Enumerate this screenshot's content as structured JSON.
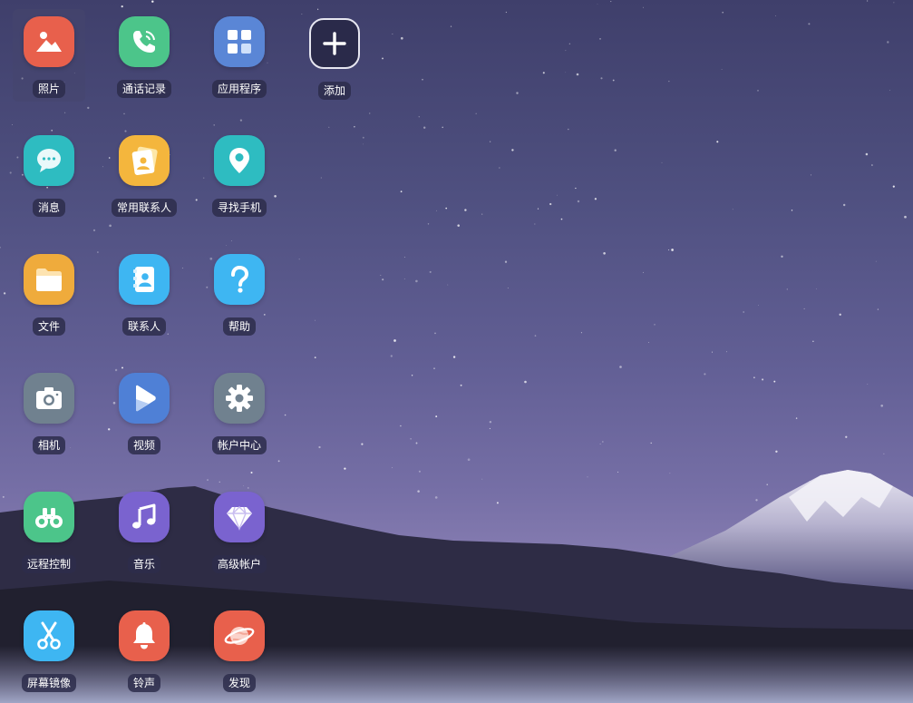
{
  "apps": [
    {
      "id": "photos",
      "label": "照片",
      "icon": "photos-icon",
      "color": "#e8604c",
      "selected": true
    },
    {
      "id": "call-log",
      "label": "通话记录",
      "icon": "phone-icon",
      "color": "#4cc58a"
    },
    {
      "id": "apps",
      "label": "应用程序",
      "icon": "grid-icon",
      "color": "#5a86d6"
    },
    {
      "id": "add",
      "label": "添加",
      "icon": "plus-icon",
      "color": "#2a2a46"
    },
    {
      "id": "messages",
      "label": "消息",
      "icon": "chat-bubble-icon",
      "color": "#2ebcc1"
    },
    {
      "id": "favorite-contacts",
      "label": "常用联系人",
      "icon": "contact-card-icon",
      "color": "#f4b63d"
    },
    {
      "id": "find-phone",
      "label": "寻找手机",
      "icon": "location-pin-icon",
      "color": "#2ebcc1"
    },
    {
      "id": "files",
      "label": "文件",
      "icon": "folder-icon",
      "color": "#efab3c"
    },
    {
      "id": "contacts",
      "label": "联系人",
      "icon": "address-book-icon",
      "color": "#3eb6f2"
    },
    {
      "id": "help",
      "label": "帮助",
      "icon": "question-icon",
      "color": "#3eb6f2"
    },
    {
      "id": "camera",
      "label": "相机",
      "icon": "camera-icon",
      "color": "#70818f"
    },
    {
      "id": "video",
      "label": "视频",
      "icon": "play-icon",
      "color": "#4f80d6"
    },
    {
      "id": "account-center",
      "label": "帐户中心",
      "icon": "gear-icon",
      "color": "#70818f"
    },
    {
      "id": "remote-control",
      "label": "远程控制",
      "icon": "binoculars-icon",
      "color": "#4cc58a"
    },
    {
      "id": "music",
      "label": "音乐",
      "icon": "music-note-icon",
      "color": "#7a63cf"
    },
    {
      "id": "premium-account",
      "label": "高级帐户",
      "icon": "diamond-icon",
      "color": "#7a63cf"
    },
    {
      "id": "screen-mirroring",
      "label": "屏幕镜像",
      "icon": "scissors-icon",
      "color": "#3eb6f2"
    },
    {
      "id": "ringtone",
      "label": "铃声",
      "icon": "bell-icon",
      "color": "#e8604c"
    },
    {
      "id": "discover",
      "label": "发现",
      "icon": "planet-icon",
      "color": "#e8604c"
    }
  ]
}
